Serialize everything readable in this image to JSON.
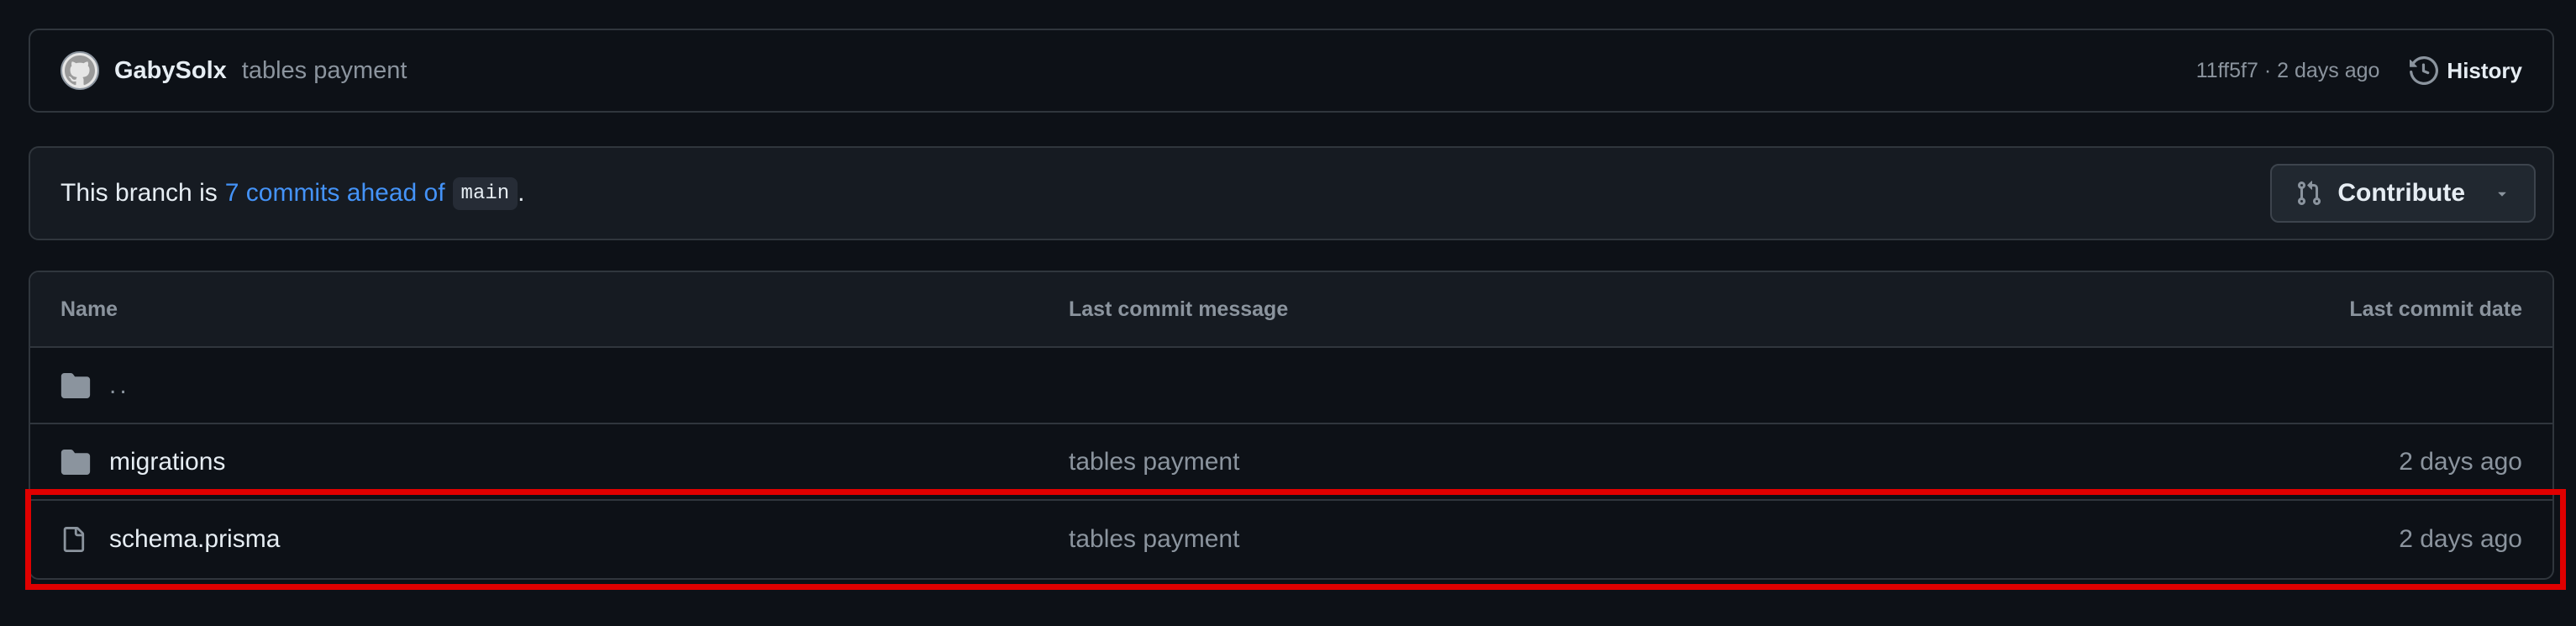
{
  "commit_bar": {
    "author": "GabySolx",
    "message": "tables payment",
    "meta": "11ff5f7 · 2 days ago",
    "history_label": "History",
    "avatar_icon": "github-avatar-icon",
    "history_icon": "history-icon"
  },
  "branch_bar": {
    "prefix": "This branch is",
    "link_text": "7 commits ahead of",
    "branch": "main",
    "suffix": ".",
    "contribute_label": "Contribute",
    "contribute_icon": "git-pull-request-icon"
  },
  "table": {
    "headers": {
      "name": "Name",
      "message": "Last commit message",
      "date": "Last commit date"
    },
    "rows": [
      {
        "type": "parent",
        "name": "..",
        "message": "",
        "date": "",
        "icon": "folder-icon"
      },
      {
        "type": "folder",
        "name": "migrations",
        "message": "tables payment",
        "date": "2 days ago",
        "icon": "folder-icon"
      },
      {
        "type": "file",
        "name": "schema.prisma",
        "message": "tables payment",
        "date": "2 days ago",
        "icon": "file-icon"
      }
    ]
  },
  "colors": {
    "background": "#0d1117",
    "border": "#30363d",
    "link": "#4493f8",
    "muted": "#8b949e",
    "highlight": "#e00000"
  }
}
